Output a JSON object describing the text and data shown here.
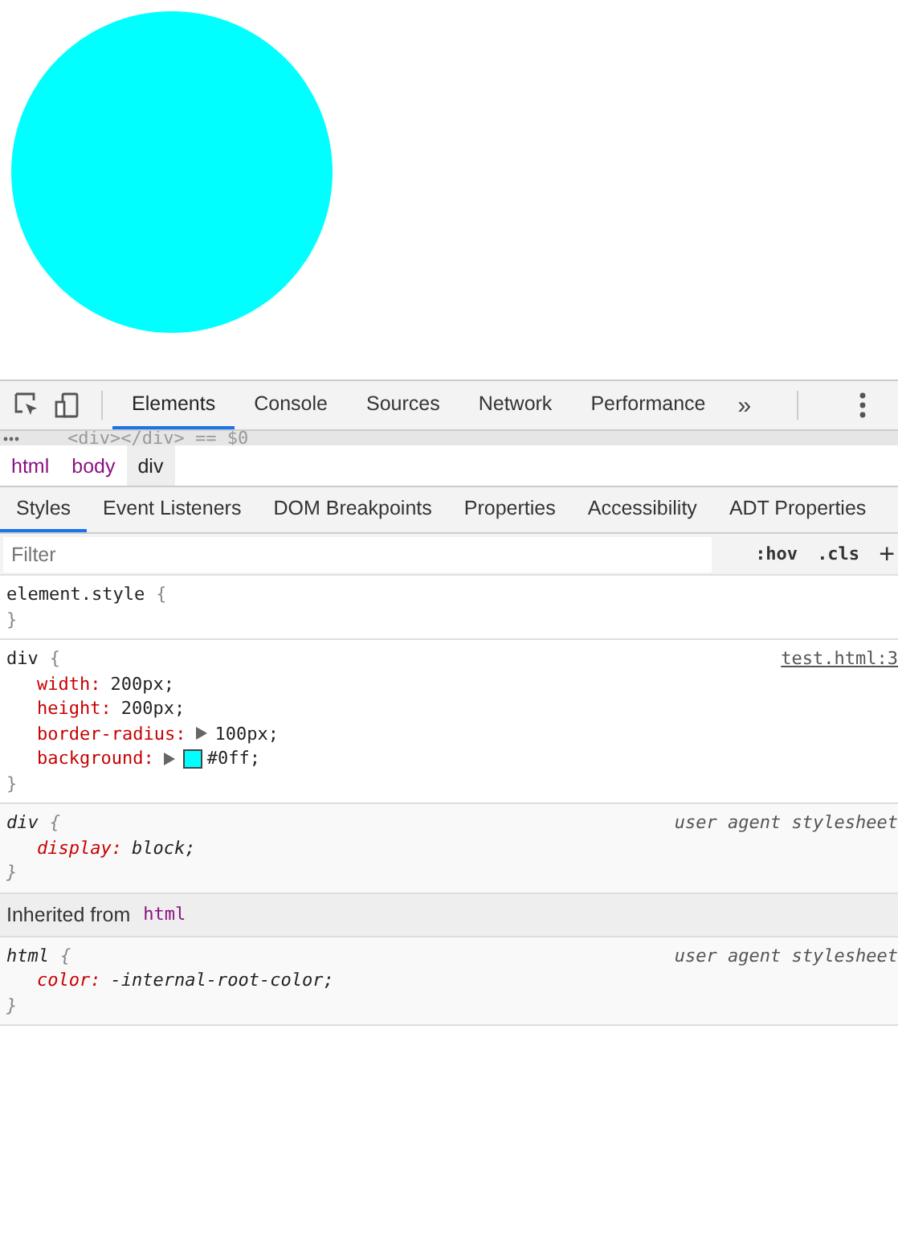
{
  "preview": {
    "color": "#00ffff"
  },
  "toolbar": {
    "tabs": [
      {
        "label": "Elements",
        "selected": true
      },
      {
        "label": "Console",
        "selected": false
      },
      {
        "label": "Sources",
        "selected": false
      },
      {
        "label": "Network",
        "selected": false
      },
      {
        "label": "Performance",
        "selected": false
      }
    ],
    "overflow": "»"
  },
  "dom_line": "<div></div> == $0",
  "breadcrumbs": [
    {
      "label": "html",
      "selected": false
    },
    {
      "label": "body",
      "selected": false
    },
    {
      "label": "div",
      "selected": true
    }
  ],
  "panel_tabs": [
    {
      "label": "Styles",
      "selected": true
    },
    {
      "label": "Event Listeners",
      "selected": false
    },
    {
      "label": "DOM Breakpoints",
      "selected": false
    },
    {
      "label": "Properties",
      "selected": false
    },
    {
      "label": "Accessibility",
      "selected": false
    },
    {
      "label": "ADT Properties",
      "selected": false
    }
  ],
  "filter": {
    "placeholder": "Filter",
    "hov": ":hov",
    "cls": ".cls",
    "add": "+"
  },
  "rules": [
    {
      "kind": "inline",
      "selector": "element.style",
      "open": "{",
      "close": "}"
    },
    {
      "kind": "author",
      "selector": "div",
      "open": "{",
      "close": "}",
      "source": "test.html:3",
      "declarations": [
        {
          "kind": "plain",
          "property": "width:",
          "value": "200px;"
        },
        {
          "kind": "plain",
          "property": "height:",
          "value": "200px;"
        },
        {
          "kind": "expandable",
          "property": "border-radius:",
          "value": "100px;"
        },
        {
          "kind": "color",
          "property": "background:",
          "value": "#0ff;",
          "color": "#00ffff"
        }
      ]
    },
    {
      "kind": "user-agent",
      "selector": "div",
      "open": "{",
      "close": "}",
      "source": "user agent stylesheet",
      "declarations": [
        {
          "kind": "plain",
          "property": "display:",
          "value": "block;"
        }
      ]
    },
    {
      "kind": "inherited",
      "label": "Inherited from",
      "element": "html"
    },
    {
      "kind": "user-agent",
      "selector": "html",
      "open": "{",
      "close": "}",
      "source": "user agent stylesheet",
      "declarations": [
        {
          "kind": "plain",
          "property": "color:",
          "value": "-internal-root-color;"
        }
      ]
    }
  ]
}
